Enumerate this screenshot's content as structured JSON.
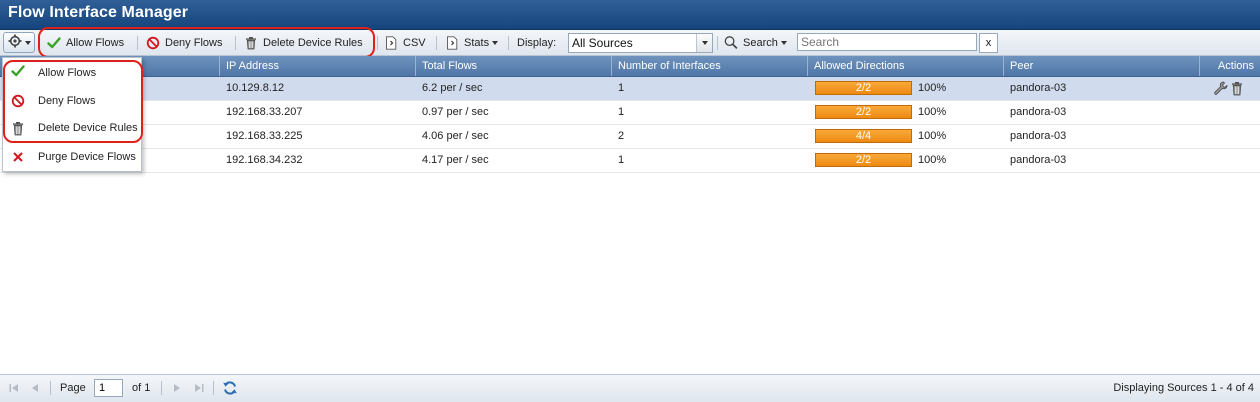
{
  "window": {
    "title": "Flow Interface Manager"
  },
  "toolbar": {
    "allow_flows": "Allow Flows",
    "deny_flows": "Deny Flows",
    "delete_device_rules": "Delete Device Rules",
    "csv": "CSV",
    "stats": "Stats",
    "display_label": "Display:",
    "display_value": "All Sources",
    "search_label": "Search",
    "search_placeholder": "Search",
    "clear_symbol": "x"
  },
  "table": {
    "columns": [
      "IP Address",
      "Total Flows",
      "Number of Interfaces",
      "Allowed Directions",
      "Peer",
      "Actions"
    ],
    "rows": [
      {
        "ip": "10.129.8.12",
        "flows": "6.2 per / sec",
        "interfaces": "1",
        "directions": "2/2",
        "percent": "100%",
        "peer": "pandora-03",
        "selected": true
      },
      {
        "ip": "192.168.33.207",
        "flows": "0.97 per / sec",
        "interfaces": "1",
        "directions": "2/2",
        "percent": "100%",
        "peer": "pandora-03",
        "selected": false
      },
      {
        "ip": "192.168.33.225",
        "flows": "4.06 per / sec",
        "interfaces": "2",
        "directions": "4/4",
        "percent": "100%",
        "peer": "pandora-03",
        "selected": false
      },
      {
        "ip": "192.168.34.232",
        "flows": "4.17 per / sec",
        "interfaces": "1",
        "directions": "2/2",
        "percent": "100%",
        "peer": "pandora-03",
        "selected": false
      }
    ]
  },
  "menu": {
    "items": [
      {
        "label": "Allow Flows",
        "icon": "check-icon"
      },
      {
        "label": "Deny Flows",
        "icon": "deny-icon"
      },
      {
        "label": "Delete Device Rules",
        "icon": "trash-icon"
      },
      {
        "label": "Purge Device Flows",
        "icon": "close-x-icon"
      }
    ]
  },
  "pager": {
    "page_label": "Page",
    "page_value": "1",
    "of_label": "of 1",
    "status": "Displaying Sources 1 - 4 of 4"
  },
  "colors": {
    "title_bar": "#1f4f8a",
    "header": "#5f84b3",
    "bar_orange": "#f29a21",
    "highlight_red": "#e0211b",
    "selected_row": "#d0dbed"
  }
}
